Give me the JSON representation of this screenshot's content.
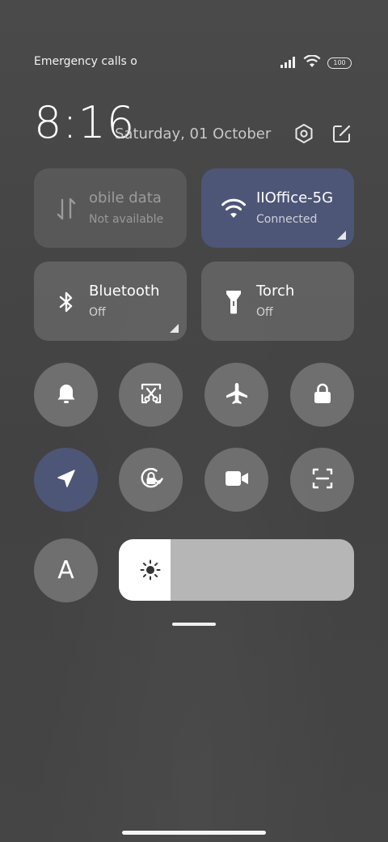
{
  "status_bar": {
    "left_text": "Emergency calls o",
    "battery_level": "100",
    "icons": [
      "signal-icon",
      "wifi-icon",
      "battery-icon"
    ]
  },
  "header": {
    "time": "8:16",
    "date": "Saturday, 01 October",
    "icons": [
      "settings-icon",
      "edit-icon"
    ]
  },
  "tiles": [
    {
      "id": "mobile-data",
      "title": "obile data",
      "subtitle": "Not available",
      "state": "disabled",
      "icon": "mobile-data-icon"
    },
    {
      "id": "wifi",
      "title": "IIOffice-5G",
      "subtitle": "Connected",
      "state": "active",
      "icon": "wifi-icon"
    },
    {
      "id": "bluetooth",
      "title": "Bluetooth",
      "subtitle": "Off",
      "state": "inactive",
      "icon": "bluetooth-icon"
    },
    {
      "id": "torch",
      "title": "Torch",
      "subtitle": "Off",
      "state": "inactive",
      "icon": "torch-icon"
    }
  ],
  "toggles_row1": [
    {
      "id": "sound",
      "icon": "bell-icon",
      "state": "inactive"
    },
    {
      "id": "screenshot",
      "icon": "screenshot-icon",
      "state": "inactive"
    },
    {
      "id": "airplane-mode",
      "icon": "airplane-icon",
      "state": "inactive"
    },
    {
      "id": "lock-screen",
      "icon": "lock-icon",
      "state": "inactive"
    }
  ],
  "toggles_row2": [
    {
      "id": "location",
      "icon": "location-icon",
      "state": "active"
    },
    {
      "id": "rotation-lock",
      "icon": "rotation-lock-icon",
      "state": "inactive"
    },
    {
      "id": "screen-recorder",
      "icon": "video-icon",
      "state": "inactive"
    },
    {
      "id": "scanner",
      "icon": "scan-icon",
      "state": "inactive"
    }
  ],
  "font_button": {
    "label": "A"
  },
  "brightness": {
    "level": 0.22,
    "icon": "brightness-icon"
  },
  "colors": {
    "active_tile": "#4e5677",
    "inactive_tile": "#787878",
    "brightness_track": "#b6b6b6",
    "brightness_fill": "#ffffff"
  }
}
